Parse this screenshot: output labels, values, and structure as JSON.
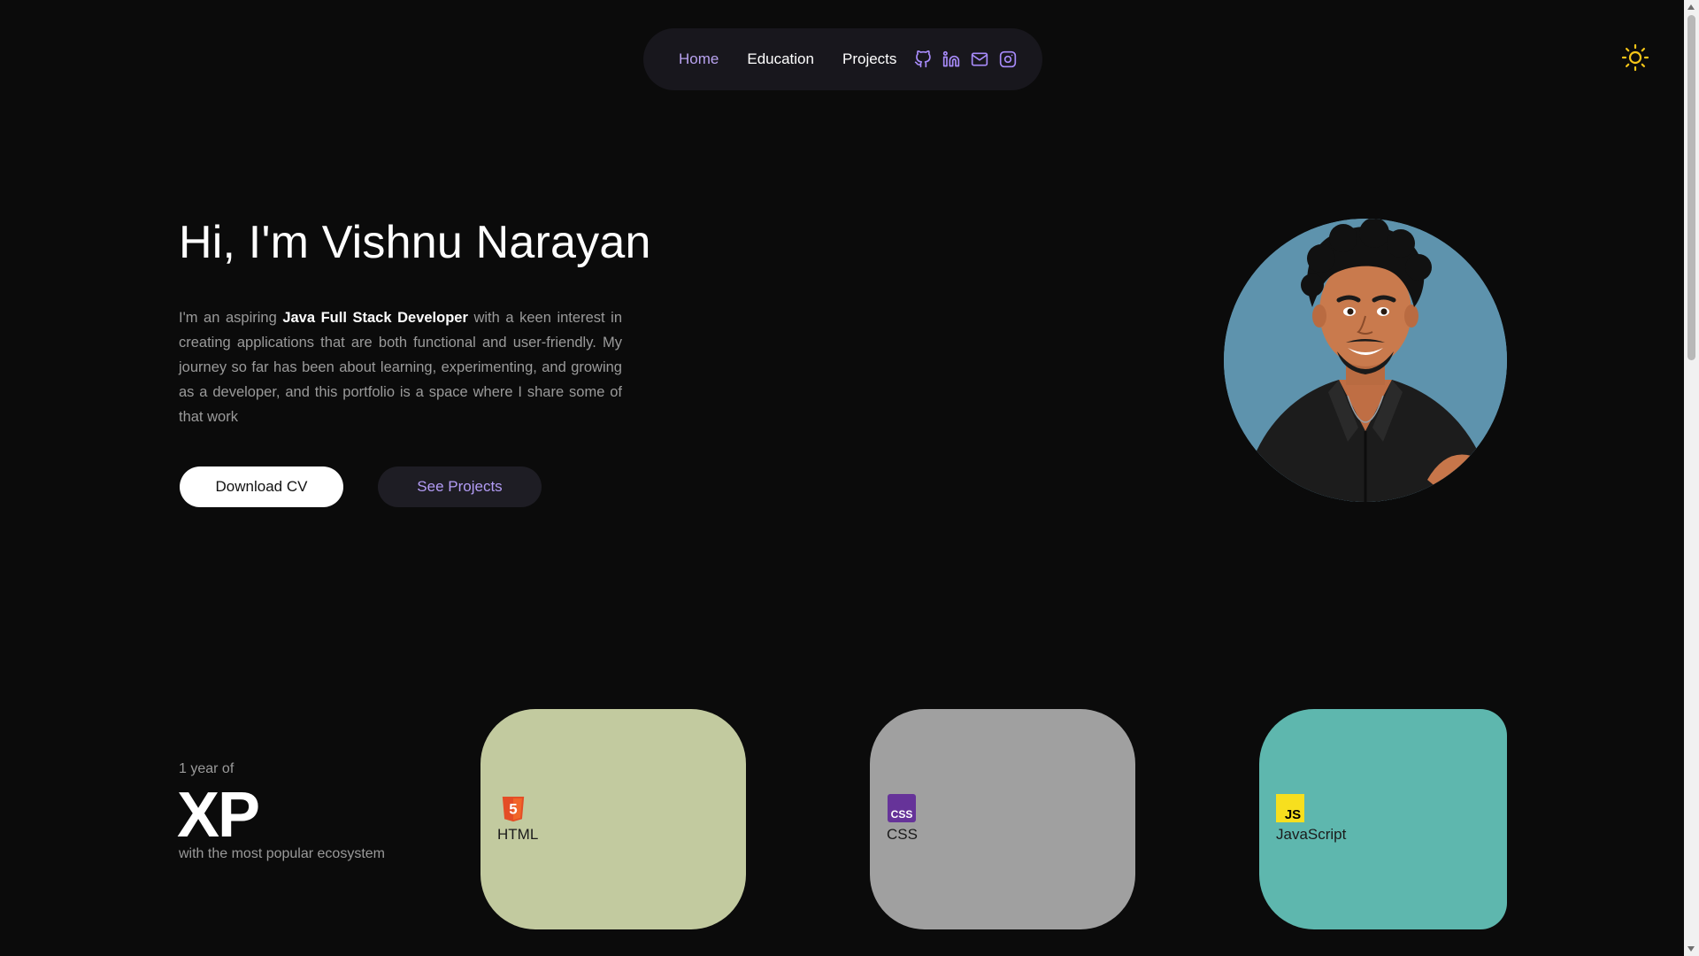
{
  "nav": {
    "items": [
      {
        "label": "Home",
        "active": true
      },
      {
        "label": "Education",
        "active": false
      },
      {
        "label": "Projects",
        "active": false
      }
    ],
    "icons": [
      "github-icon",
      "linkedin-icon",
      "mail-icon",
      "instagram-icon"
    ]
  },
  "theme_toggle": {
    "icon": "sun-icon",
    "color": "#f5c518"
  },
  "hero": {
    "title": "Hi, I'm Vishnu Narayan",
    "desc_pre": "I'm an aspiring ",
    "desc_bold": "Java Full Stack Developer",
    "desc_post": " with a keen interest in creating applications that are both functional and user-friendly. My journey so far has been about learning, experimenting, and growing as a developer, and this portfolio is a space where I share some of that work",
    "btn_cv": "Download CV",
    "btn_projects": "See Projects"
  },
  "xp": {
    "small": "1 year of",
    "big": "XP",
    "sub": "with the most popular ecosystem"
  },
  "skills": [
    {
      "label": "HTML",
      "color": "#c2ca9f",
      "logo_color": "#e44d26",
      "logo_text": "5"
    },
    {
      "label": "CSS",
      "color": "#a0a0a0",
      "logo_color": "#663399",
      "logo_text": "CSS"
    },
    {
      "label": "JavaScript",
      "color": "#5eb7ae",
      "logo_color": "#f7df1e",
      "logo_text": "JS"
    }
  ],
  "colors": {
    "background": "#0b0b0b",
    "accent": "#a78bfa",
    "nav_bg": "#18171d"
  }
}
